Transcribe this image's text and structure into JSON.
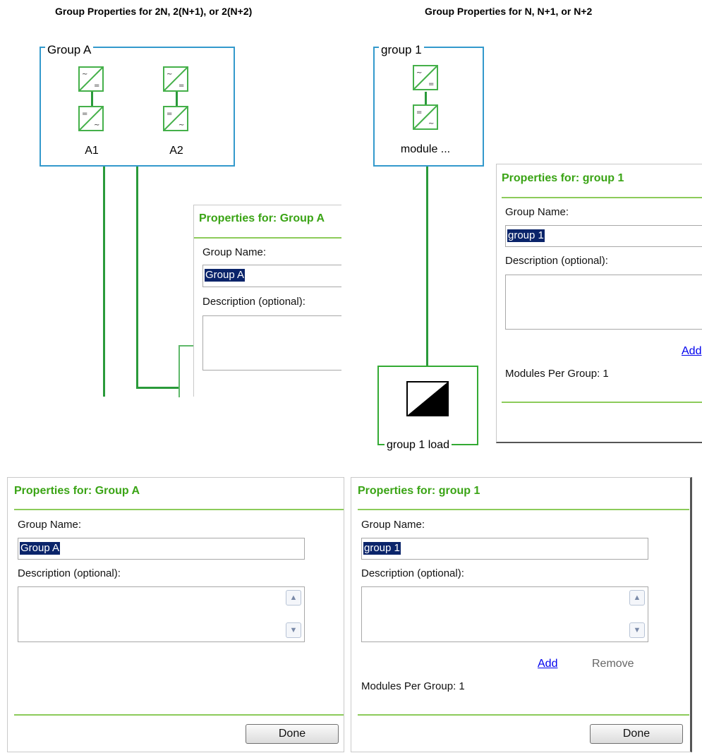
{
  "headings": {
    "left": "Group Properties for 2N, 2(N+1), or 2(N+2)",
    "right": "Group Properties for N, N+1, or N+2"
  },
  "diagram_left": {
    "group_name": "Group A",
    "modules": [
      "A1",
      "A2"
    ]
  },
  "diagram_right": {
    "group_name": "group 1",
    "module_label": "module ...",
    "load_label": "group 1 load"
  },
  "overlay_left": {
    "title": "Properties for: Group A",
    "group_name_label": "Group Name:",
    "group_name_value": "Group A",
    "description_label": "Description (optional):"
  },
  "overlay_right": {
    "title": "Properties for: group 1",
    "group_name_label": "Group Name:",
    "group_name_value": "group 1",
    "description_label": "Description (optional):",
    "add_label": "Add",
    "modules_per_group": "Modules Per Group: 1"
  },
  "panel_left": {
    "title": "Properties for: Group A",
    "group_name_label": "Group Name:",
    "group_name_value": "Group A",
    "description_label": "Description (optional):",
    "done_label": "Done"
  },
  "panel_right": {
    "title": "Properties for: group 1",
    "group_name_label": "Group Name:",
    "group_name_value": "group 1",
    "description_label": "Description (optional):",
    "add_label": "Add",
    "remove_label": "Remove",
    "modules_per_group": "Modules Per Group: 1",
    "done_label": "Done"
  },
  "icons": {
    "inverter": "ac-dc-converter-icon",
    "load": "load-icon",
    "scroll_up": "chevron-up-icon",
    "scroll_down": "chevron-down-icon"
  },
  "colors": {
    "group_border": "#3399cc",
    "wire": "#2a9a3a",
    "title_green": "#3aa415",
    "selection": "#0a246a"
  }
}
